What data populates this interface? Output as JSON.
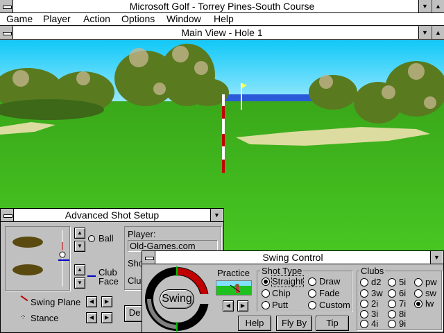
{
  "app": {
    "title": "Microsoft Golf - Torrey Pines-South Course",
    "menu": [
      "Game",
      "Player",
      "Action",
      "Options",
      "Window",
      "Help"
    ]
  },
  "main_view": {
    "title": "Main View - Hole 1"
  },
  "advanced": {
    "title": "Advanced Shot Setup",
    "ball_label": "Ball",
    "club_face_label_1": "Club",
    "club_face_label_2": "Face",
    "swing_plane_label": "Swing Plane",
    "stance_label": "Stance",
    "player_label": "Player:",
    "player_name": "Old-Games.com",
    "shot_label_partial": "Sho",
    "club_label_partial": "Clu",
    "default_button_partial": "De"
  },
  "swing": {
    "title": "Swing Control",
    "swing_button": "Swing",
    "practice_label": "Practice",
    "shot_type_label": "Shot Type",
    "shot_types": [
      "Straight",
      "Chip",
      "Putt",
      "Draw",
      "Fade",
      "Custom"
    ],
    "selected_shot_type": "Straight",
    "clubs_label": "Clubs",
    "clubs": [
      "d2",
      "3w",
      "2i",
      "3i",
      "4i",
      "5i",
      "6i",
      "7i",
      "8i",
      "9i",
      "pw",
      "sw",
      "lw"
    ],
    "selected_club": "lw",
    "help_button": "Help",
    "flyby_button": "Fly By",
    "tip_button": "Tip"
  },
  "colors": {
    "grass": "#3fbf1f",
    "sky": "#80e0f8",
    "flag": "#ffff60",
    "pole_red": "#c00000"
  }
}
